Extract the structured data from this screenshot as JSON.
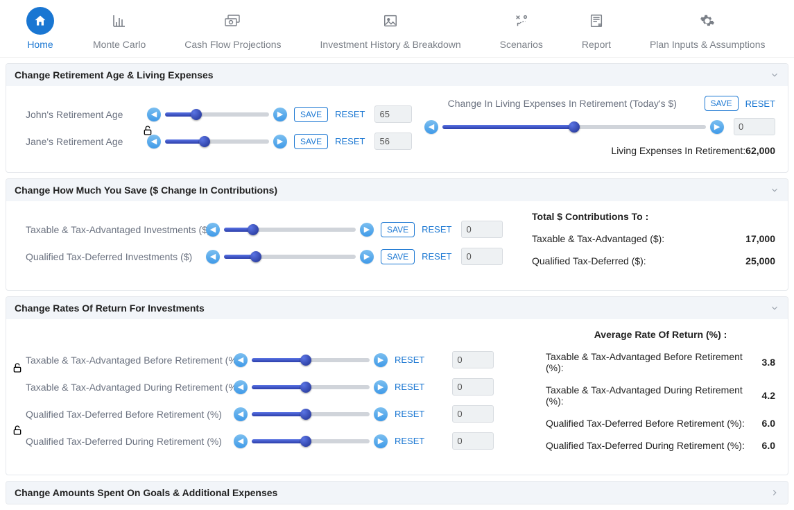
{
  "tabs": [
    {
      "label": "Home",
      "icon": "home"
    },
    {
      "label": "Monte Carlo",
      "icon": "bars"
    },
    {
      "label": "Cash Flow Projections",
      "icon": "cashflow"
    },
    {
      "label": "Investment History & Breakdown",
      "icon": "picture"
    },
    {
      "label": "Scenarios",
      "icon": "strategy"
    },
    {
      "label": "Report",
      "icon": "report"
    },
    {
      "label": "Plan Inputs & Assumptions",
      "icon": "gear"
    }
  ],
  "panels": {
    "age": {
      "title": "Change Retirement Age & Living Expenses",
      "john": {
        "label": "John's Retirement Age",
        "value": "65",
        "save": "SAVE",
        "reset": "RESET",
        "fill_pct": 30
      },
      "jane": {
        "label": "Jane's Retirement Age",
        "value": "56",
        "save": "SAVE",
        "reset": "RESET",
        "fill_pct": 38
      },
      "living": {
        "heading": "Change In Living Expenses In Retirement (Today's $)",
        "save": "SAVE",
        "reset": "RESET",
        "value": "0",
        "fill_pct": 50,
        "summary_label": "Living Expenses In Retirement:",
        "summary_value": "62,000"
      }
    },
    "save": {
      "title": "Change How Much You Save ($ Change In Contributions)",
      "taxable": {
        "label": "Taxable & Tax-Advantaged Investments ($)",
        "value": "0",
        "save": "SAVE",
        "reset": "RESET",
        "fill_pct": 22
      },
      "qualified": {
        "label": "Qualified Tax-Deferred Investments ($)",
        "value": "0",
        "save": "SAVE",
        "reset": "RESET",
        "fill_pct": 24
      },
      "totals": {
        "heading": "Total $ Contributions To :",
        "taxable_label": "Taxable & Tax-Advantaged ($):",
        "taxable_value": "17,000",
        "qualified_label": "Qualified Tax-Deferred ($):",
        "qualified_value": "25,000"
      }
    },
    "rates": {
      "title": "Change Rates Of Return For Investments",
      "r1": {
        "label": "Taxable & Tax-Advantaged Before Retirement (%)",
        "value": "0",
        "reset": "RESET",
        "fill_pct": 46
      },
      "r2": {
        "label": "Taxable & Tax-Advantaged During Retirement (%)",
        "value": "0",
        "reset": "RESET",
        "fill_pct": 46
      },
      "r3": {
        "label": "Qualified Tax-Deferred Before Retirement (%)",
        "value": "0",
        "reset": "RESET",
        "fill_pct": 46
      },
      "r4": {
        "label": "Qualified Tax-Deferred During Retirement (%)",
        "value": "0",
        "reset": "RESET",
        "fill_pct": 46
      },
      "avg": {
        "heading": "Average Rate Of Return (%) :",
        "l1": "Taxable & Tax-Advantaged Before Retirement (%):",
        "v1": "3.8",
        "l2": "Taxable & Tax-Advantaged During Retirement (%):",
        "v2": "4.2",
        "l3": "Qualified Tax-Deferred Before Retirement (%):",
        "v3": "6.0",
        "l4": "Qualified Tax-Deferred During Retirement (%):",
        "v4": "6.0"
      }
    },
    "goals": {
      "title": "Change Amounts Spent On Goals & Additional Expenses"
    }
  }
}
